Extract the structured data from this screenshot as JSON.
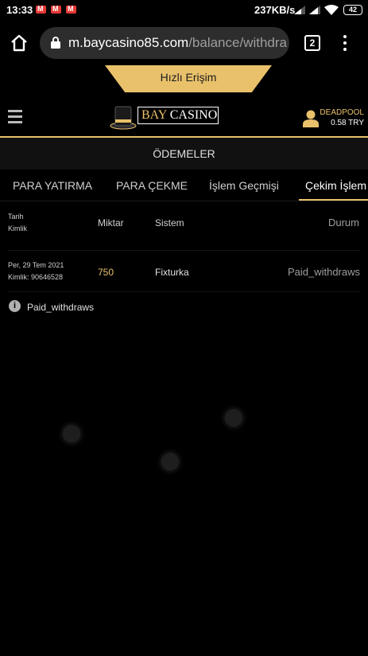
{
  "status_bar": {
    "time": "13:33",
    "notification_icons": [
      "gmail-icon",
      "gmail-icon",
      "gmail-icon"
    ],
    "network_speed": "237KB/s",
    "battery": "42"
  },
  "browser": {
    "url_host": "m.baycasino85.com",
    "url_path": "/balance/withdra",
    "tab_count": "2"
  },
  "quick_access": {
    "label": "Hızlı Erişim"
  },
  "header": {
    "logo_primary": "BAY",
    "logo_secondary": "CASINO",
    "username": "DEADPOOL",
    "balance": "0.58 TRY"
  },
  "section": {
    "title": "ÖDEMELER"
  },
  "tabs": [
    {
      "label": "PARA YATIRMA",
      "active": false
    },
    {
      "label": "PARA ÇEKME",
      "active": false
    },
    {
      "label": "İşlem Geçmişi",
      "active": false
    },
    {
      "label": "Çekim İşlem",
      "active": true
    }
  ],
  "table": {
    "headers": {
      "date": "Tarih",
      "id": "Kimlik",
      "amount": "Miktar",
      "system": "Sistem",
      "status": "Durum"
    },
    "rows": [
      {
        "date": "Per, 29 Tem 2021",
        "id": "Kimlik: 90646528",
        "amount": "750",
        "system": "Fixturka",
        "status": "Paid_withdraws"
      }
    ]
  },
  "info": {
    "text": "Paid_withdraws"
  },
  "colors": {
    "accent": "#e9c16b",
    "background": "#000000",
    "url_bar": "#2d2d2d"
  }
}
